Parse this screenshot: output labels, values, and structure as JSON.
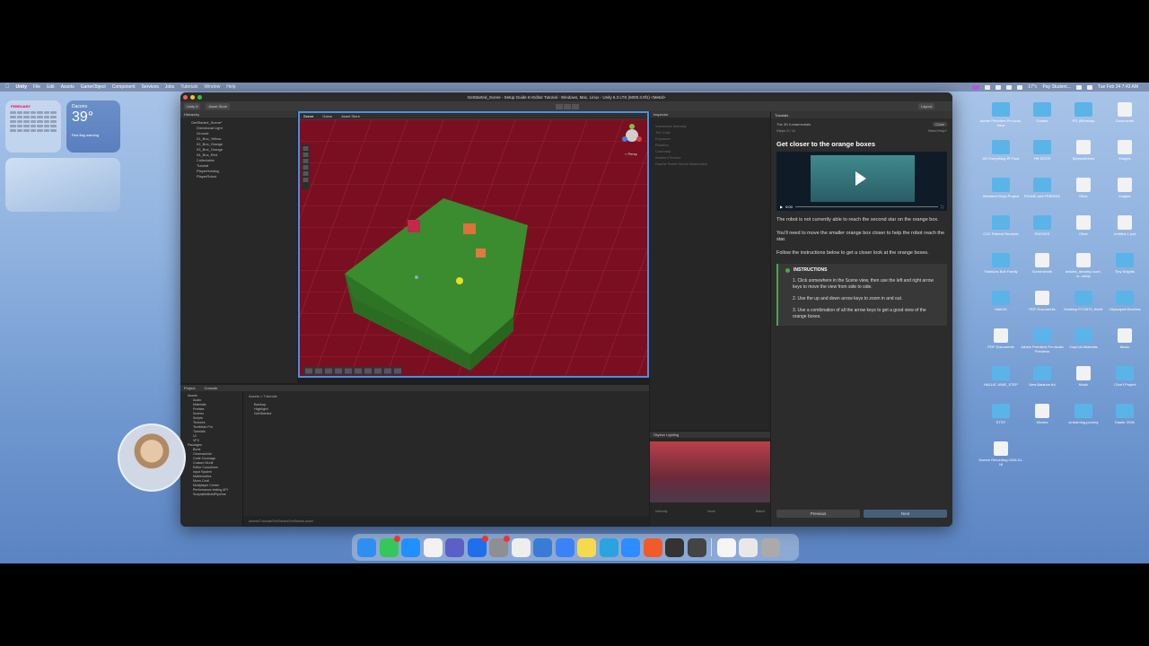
{
  "menubar": {
    "app": "Unity",
    "items": [
      "File",
      "Edit",
      "Assets",
      "GameObject",
      "Component",
      "Services",
      "Jobs",
      "Tutorials",
      "Window",
      "Help"
    ],
    "status_text": "Pay Student...",
    "clock": "Tue Feb 24  7:43 AM",
    "temp": "17°c"
  },
  "widgets": {
    "calendar_month": "FEBRUARY",
    "weather_city": "Dacono",
    "weather_temp": "39°",
    "weather_cond": "Red flag warning"
  },
  "window": {
    "title": "GetStarted_Scene - Setup Guide In-Editor Tutorial - Windows, Mac, Linux - Unity 6.3 LTS (6000.3.9f1) <Metal>",
    "toolbar": [
      "Unity 6",
      "Asset Store",
      "Layout"
    ]
  },
  "hierarchy": {
    "tab": "Hierarchy",
    "scene": "GetStarted_Scene*",
    "items": [
      "Directional Light",
      "Ground",
      "01_Box_Yellow",
      "02_Box_Orange",
      "03_Box_Orange",
      "04_Box_Red",
      "Collectable",
      "Tutorial",
      "PlayerHolding",
      "PlayerRobot"
    ]
  },
  "scene_tabs": [
    "Scene",
    "Game",
    "Asset Store"
  ],
  "scene_persp_label": "< Persp",
  "inspector": {
    "tab": "Inspector",
    "rows": [
      "Volumetric Intensity",
      "Tint Color",
      "Exposure",
      "Rotation",
      "Cubemap",
      "Ambient Source",
      "Double Sided Global Illumination"
    ]
  },
  "project": {
    "tabs": [
      "Project",
      "Console"
    ],
    "breadcrumb": "Assets > Tutorials",
    "folders": [
      "Assets",
      "Audio",
      "Materials",
      "Prefabs",
      "Scenes",
      "Scripts",
      "Textures",
      "TextMesh Pro",
      "Tutorials",
      "UI",
      "VFX",
      "Packages",
      "Burst",
      "Cinemachine",
      "Code Coverage",
      "Custom NUnit",
      "Editor Coroutines",
      "Input System",
      "Mathematics",
      "Mono Cecil",
      "Multiplayer Center",
      "Performance testing API",
      "ScriptableBuildPipeline"
    ],
    "files": [
      "Backup",
      "Highlight",
      "GetStarted"
    ],
    "path": "Assets/Tutorials/GetStarted/GetStarted.asset"
  },
  "preview": {
    "title": "Skybox Lighting",
    "footer_left": "Intensity",
    "footer_mid": "None",
    "footer_right": "Baked"
  },
  "tutorial": {
    "tab": "Tutorials",
    "subtitle": "The 3D fundamentals",
    "close": "Close",
    "step": "Steps 5 / 11",
    "help": "Need Help?",
    "heading": "Get closer to the orange boxes",
    "video_time": "0:00",
    "p1": "The robot is not currently able to reach the second star on the orange box.",
    "p2": "You'll need to move the smaller orange box closer to help the robot reach the star.",
    "p3": "Follow the instructions below to get a closer look at the orange boxes.",
    "instructions_title": "INSTRUCTIONS",
    "instructions": [
      "1.  Click somewhere in the Scene view, then use the left and right arrow keys to move the view from side to side.",
      "2.  Use the up and down arrow keys to zoom in and out.",
      "3.  Use a combination of all the arrow keys to get a good view of the orange boxes."
    ],
    "previous": "Previous",
    "next": "Next"
  },
  "desktop_icons": [
    "Adobe Premiere Pro Auto-Save",
    "Guitars",
    "PG Workshop",
    "Documents",
    "DH Everything IR Pack",
    "HR DOCS",
    "Spreadsheets",
    "Images",
    "Weekend Keys Project",
    "FRANK and FRIENDS",
    "Other",
    "Images",
    "CSC Retreat Receipts",
    "EBOOKS",
    "Other",
    "Untitled-1.psd",
    "Fashions Bob Family",
    "Screenshots",
    "articles_dreamy-room-w...webp",
    "Tiny Knights",
    "Halle10",
    "PDF Documents",
    "Desktop-FCO570_fenbk",
    "Cityscapes Brushes",
    "PDF Documents",
    "Adobe Premiere Pro Audio Previews",
    "CapCut Materials",
    "Music",
    "HALLIE JANE_STEP",
    "New Balance Ad",
    "Music",
    "I Don't Project",
    "ETSY",
    "Movies",
    "ai-learning-journey",
    "Easter 2026",
    "Screen Recording 2026-01-16"
  ],
  "colors": {
    "scene_bg": "#7a0f22",
    "ground": "#3a8c2f",
    "accent": "#4a90e2",
    "instructions_accent": "#3fae48"
  }
}
